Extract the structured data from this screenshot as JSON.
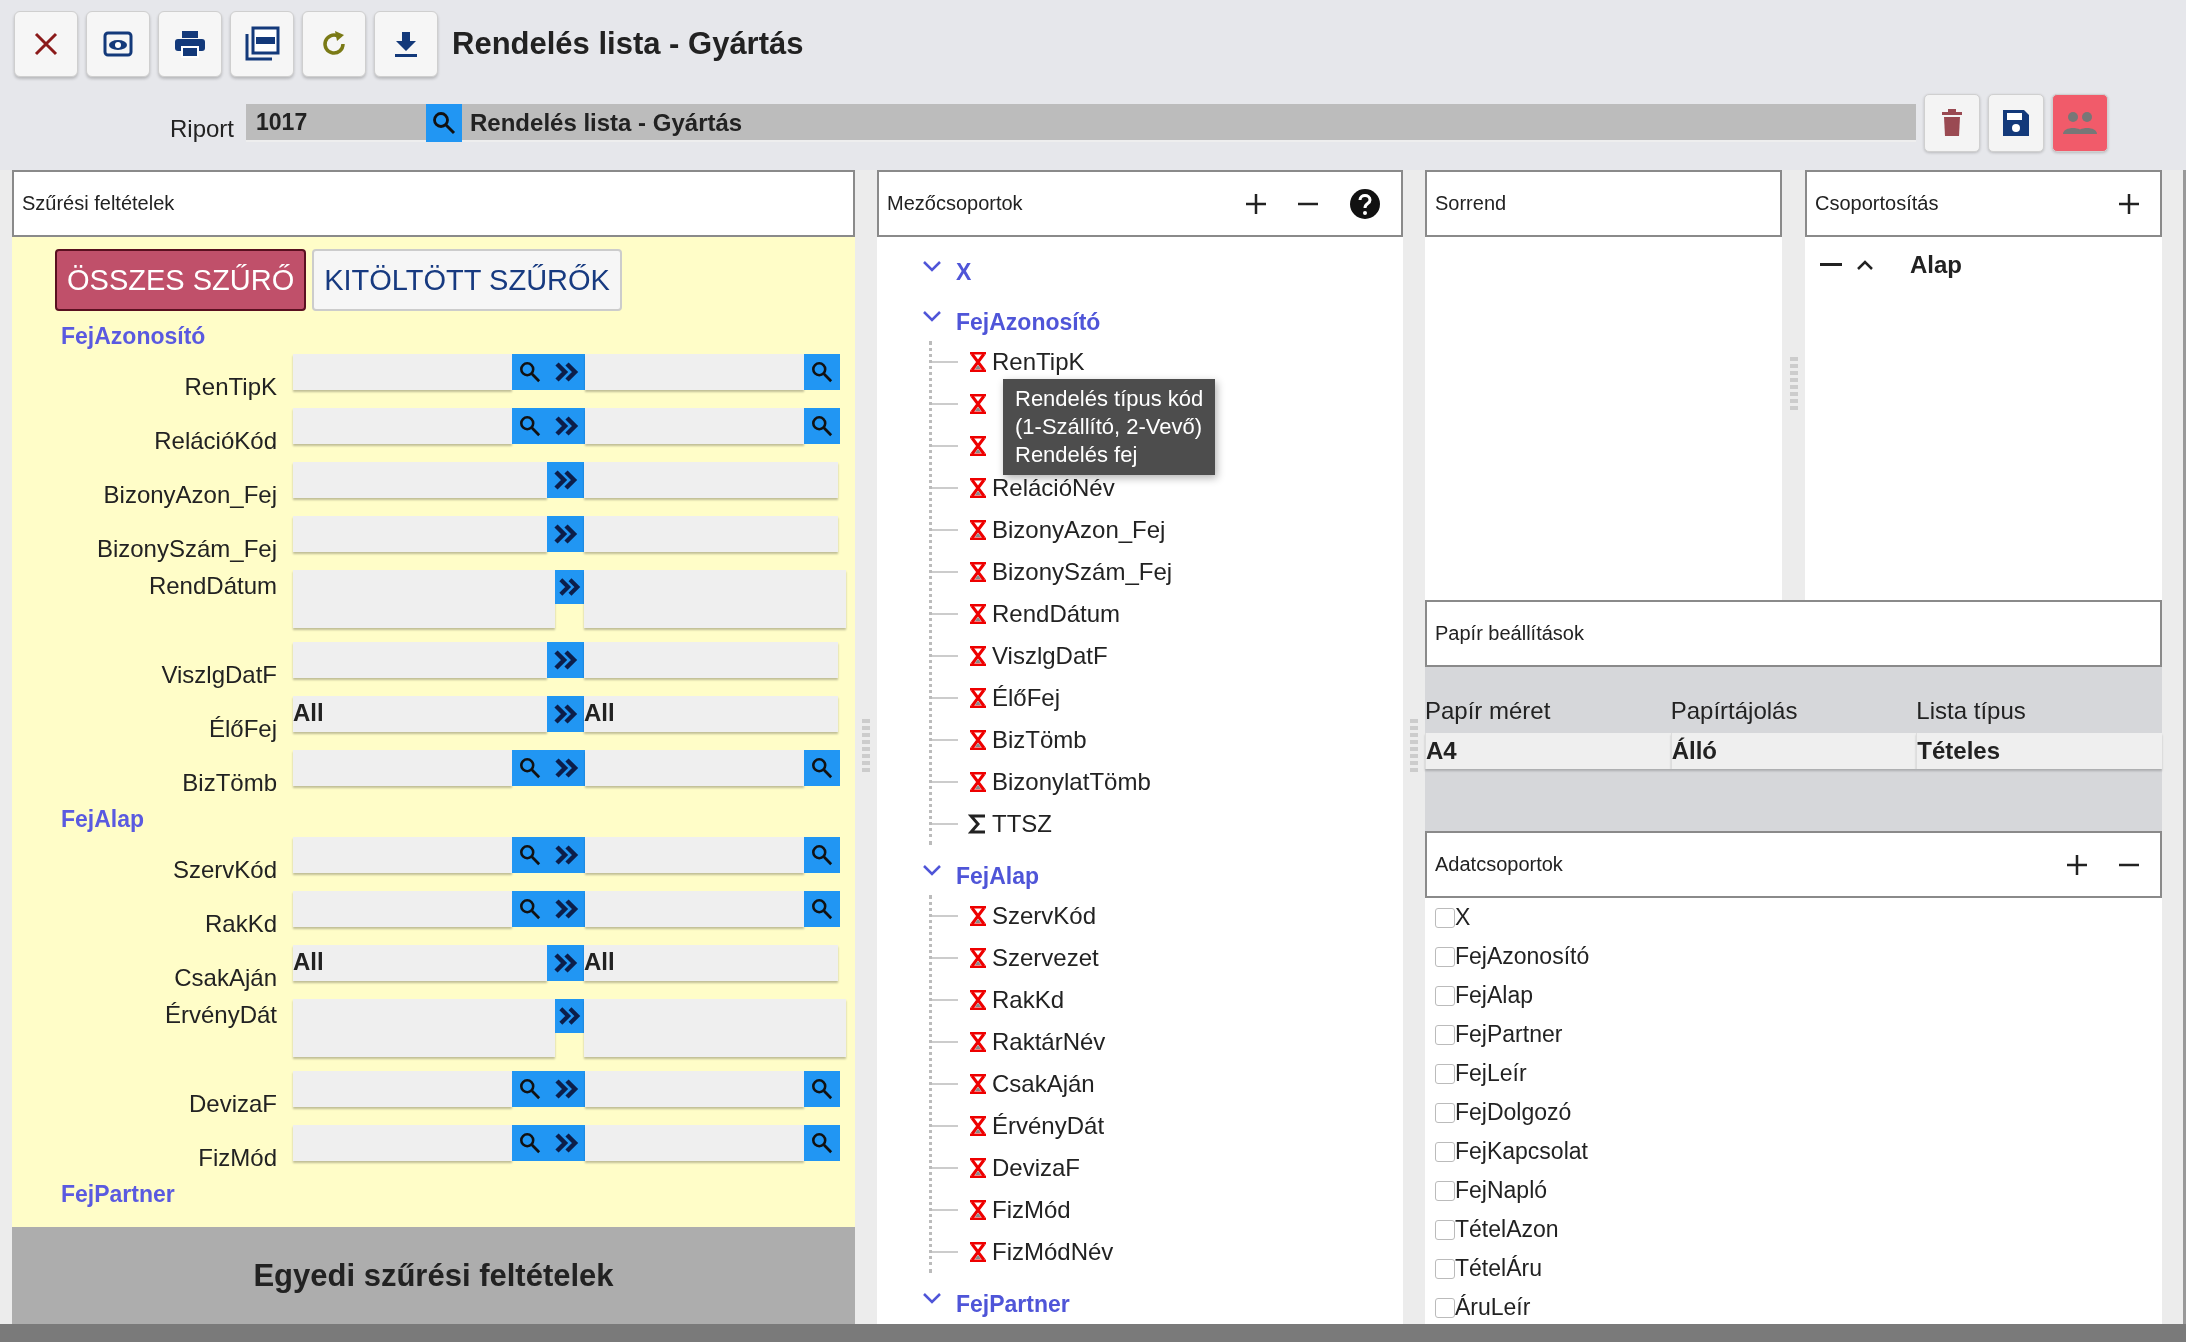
{
  "title": "Rendelés lista - Gyártás",
  "report": {
    "label": "Riport",
    "code": "1017",
    "name": "Rendelés lista - Gyártás"
  },
  "filters": {
    "title": "Szűrési feltételek",
    "tabs": [
      {
        "label": "ÖSSZES SZŰRŐ",
        "selected": true
      },
      {
        "label": "KITÖLTÖTT SZŰRŐK",
        "selected": false
      }
    ],
    "groups": [
      {
        "title": "FejAzonosító",
        "rows": [
          {
            "label": "RenTipK",
            "kind": "lookup"
          },
          {
            "label": "RelációKód",
            "kind": "lookup"
          },
          {
            "label": "BizonyAzon_Fej",
            "kind": "range"
          },
          {
            "label": "BizonySzám_Fej",
            "kind": "range"
          },
          {
            "label": "RendDátum",
            "kind": "date"
          },
          {
            "label": "ViszlgDatF",
            "kind": "range"
          },
          {
            "label": "ÉlőFej",
            "kind": "select",
            "from": "All",
            "to": "All"
          },
          {
            "label": "BizTömb",
            "kind": "lookup"
          }
        ]
      },
      {
        "title": "FejAlap",
        "rows": [
          {
            "label": "SzervKód",
            "kind": "lookup"
          },
          {
            "label": "RakKd",
            "kind": "lookup"
          },
          {
            "label": "CsakAján",
            "kind": "select",
            "from": "All",
            "to": "All"
          },
          {
            "label": "ÉrvényDát",
            "kind": "date"
          },
          {
            "label": "DevizaF",
            "kind": "lookup"
          },
          {
            "label": "FizMód",
            "kind": "lookup"
          }
        ]
      },
      {
        "title": "FejPartner"
      }
    ],
    "footer": "Egyedi szűrési feltételek"
  },
  "field_groups": {
    "title": "Mezőcsoportok",
    "groups": [
      {
        "title": "X",
        "expanded": true
      },
      {
        "title": "FejAzonosító",
        "expanded": true,
        "children": [
          {
            "label": "RenTipK",
            "kind": "dimension"
          },
          {
            "kind": "dimension"
          },
          {
            "kind": "dimension"
          },
          {
            "label": "RelációNév",
            "kind": "dimension"
          },
          {
            "label": "BizonyAzon_Fej",
            "kind": "dimension"
          },
          {
            "label": "BizonySzám_Fej",
            "kind": "dimension"
          },
          {
            "label": "RendDátum",
            "kind": "dimension"
          },
          {
            "label": "ViszlgDatF",
            "kind": "dimension"
          },
          {
            "label": "ÉlőFej",
            "kind": "dimension"
          },
          {
            "label": "BizTömb",
            "kind": "dimension"
          },
          {
            "label": "BizonylatTömb",
            "kind": "dimension"
          },
          {
            "label": "TTSZ",
            "kind": "measure"
          }
        ]
      },
      {
        "title": "FejAlap",
        "expanded": true,
        "children": [
          {
            "label": "SzervKód",
            "kind": "dimension"
          },
          {
            "label": "Szervezet",
            "kind": "dimension"
          },
          {
            "label": "RakKd",
            "kind": "dimension"
          },
          {
            "label": "RaktárNév",
            "kind": "dimension"
          },
          {
            "label": "CsakAján",
            "kind": "dimension"
          },
          {
            "label": "ÉrvényDát",
            "kind": "dimension"
          },
          {
            "label": "DevizaF",
            "kind": "dimension"
          },
          {
            "label": "FizMód",
            "kind": "dimension"
          },
          {
            "label": "FizMódNév",
            "kind": "dimension"
          }
        ]
      },
      {
        "title": "FejPartner",
        "expanded": true
      }
    ],
    "tooltip": {
      "lines": [
        "Rendelés típus kód",
        "(1-Szállító, 2-Vevő)",
        "Rendelés fej"
      ]
    }
  },
  "sort": {
    "title": "Sorrend"
  },
  "grouping": {
    "title": "Csoportosítás",
    "items": [
      {
        "label": "Alap"
      }
    ]
  },
  "paper": {
    "title": "Papír beállítások",
    "fields": [
      {
        "label": "Papír méret",
        "value": "A4"
      },
      {
        "label": "Papírtájolás",
        "value": "Álló"
      },
      {
        "label": "Lista típus",
        "value": "Tételes"
      }
    ]
  },
  "data_groups": {
    "title": "Adatcsoportok",
    "items": [
      {
        "label": "X",
        "checked": false
      },
      {
        "label": "FejAzonosító",
        "checked": false
      },
      {
        "label": "FejAlap",
        "checked": false
      },
      {
        "label": "FejPartner",
        "checked": false
      },
      {
        "label": "FejLeír",
        "checked": false
      },
      {
        "label": "FejDolgozó",
        "checked": false
      },
      {
        "label": "FejKapcsolat",
        "checked": false
      },
      {
        "label": "FejNapló",
        "checked": false
      },
      {
        "label": "TételAzon",
        "checked": false
      },
      {
        "label": "TételÁru",
        "checked": false
      },
      {
        "label": "ÁruLeír",
        "checked": false
      }
    ]
  }
}
